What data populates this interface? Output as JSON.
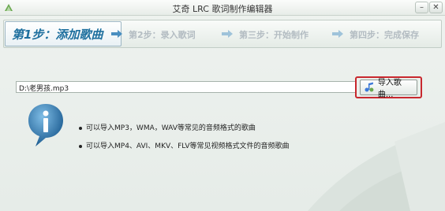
{
  "window": {
    "title": "艾奇 LRC 歌词制作编辑器",
    "minimize_glyph": "–",
    "close_glyph": "✕"
  },
  "steps": [
    {
      "label": "第1步：添加歌曲",
      "active": true
    },
    {
      "label": "第2步：录入歌词",
      "active": false
    },
    {
      "label": "第三步：开始制作",
      "active": false
    },
    {
      "label": "第四步：完成保存",
      "active": false
    }
  ],
  "file": {
    "path_value": "D:\\老男孩.mp3"
  },
  "import_button": {
    "label": "导入歌曲..."
  },
  "tips": [
    "可以导入MP3，WMA，WAV等常见的音频格式的歌曲",
    "可以导入MP4、AVI、MKV、FLV等常见视频格式文件的音频歌曲"
  ],
  "colors": {
    "accent_blue": "#1d6f9e",
    "highlight_red": "#c8282e",
    "inactive_step": "#b3bcc2"
  },
  "icons": {
    "app": "app-logo-icon",
    "info": "info-icon",
    "import": "music-note-icon",
    "arrow": "step-arrow-icon"
  }
}
